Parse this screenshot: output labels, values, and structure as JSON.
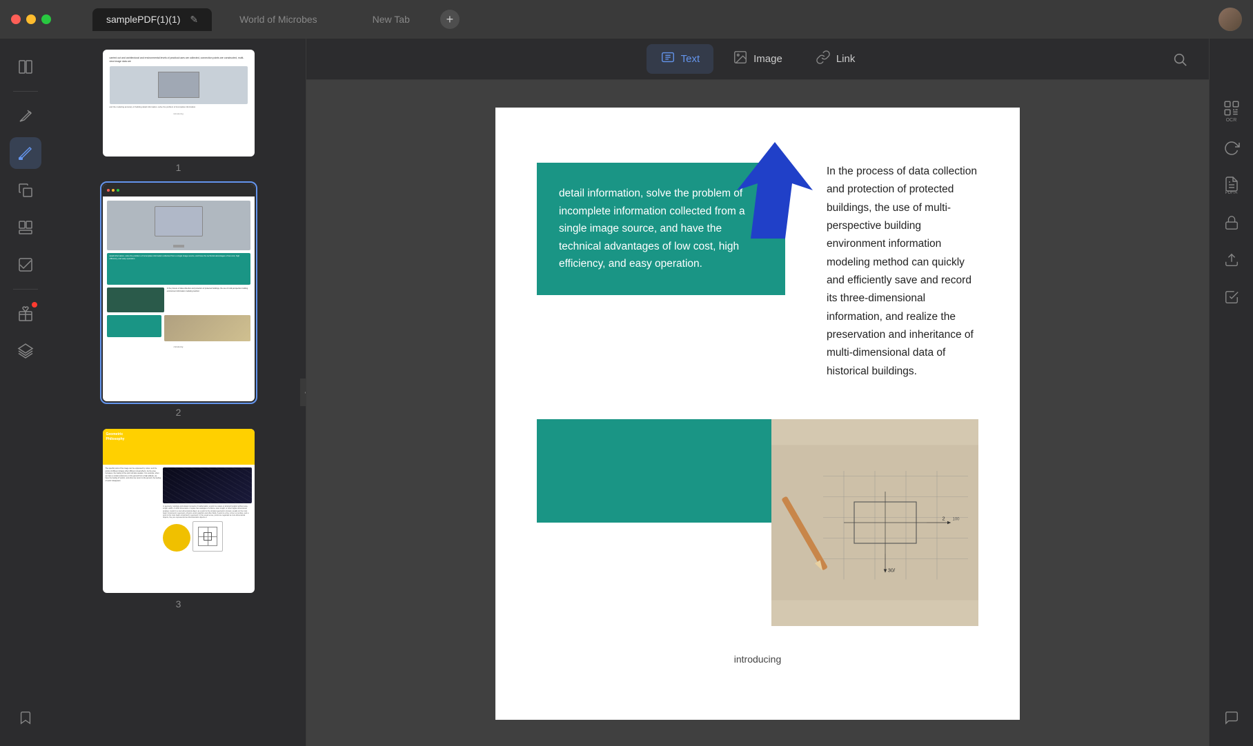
{
  "titlebar": {
    "traffic_lights": [
      "red",
      "yellow",
      "green"
    ],
    "tab_active_label": "samplePDF(1)(1)",
    "tab2_label": "World of Microbes",
    "tab3_label": "New Tab",
    "new_tab_icon": "+",
    "edit_icon": "✎"
  },
  "toolbar": {
    "text_label": "Text",
    "image_label": "Image",
    "link_label": "Link",
    "search_icon": "🔍"
  },
  "sidebar": {
    "items": [
      {
        "id": "reader",
        "icon": "📖",
        "label": "Reader"
      },
      {
        "id": "annotate",
        "icon": "✏️",
        "label": "Annotate",
        "active": true
      },
      {
        "id": "copy",
        "icon": "📋",
        "label": "Copy"
      },
      {
        "id": "organize",
        "icon": "🗂️",
        "label": "Organize"
      },
      {
        "id": "forms",
        "icon": "✅",
        "label": "Forms"
      },
      {
        "id": "gift",
        "icon": "🎁",
        "label": "Gift"
      },
      {
        "id": "layers",
        "icon": "◫",
        "label": "Layers"
      },
      {
        "id": "bookmark",
        "icon": "🔖",
        "label": "Bookmark"
      }
    ]
  },
  "right_sidebar": {
    "items": [
      {
        "id": "ocr",
        "icon": "OCR",
        "label": "OCR"
      },
      {
        "id": "refresh",
        "icon": "↺",
        "label": "Refresh"
      },
      {
        "id": "pdf-a",
        "icon": "PDF/A",
        "label": "PDF/A"
      },
      {
        "id": "lock",
        "icon": "🔒",
        "label": "Lock"
      },
      {
        "id": "share",
        "icon": "↑",
        "label": "Share"
      },
      {
        "id": "check",
        "icon": "✉",
        "label": "Check"
      },
      {
        "id": "comment",
        "icon": "💬",
        "label": "Comment"
      }
    ]
  },
  "thumbnails": [
    {
      "page_num": "1",
      "selected": false
    },
    {
      "page_num": "2",
      "selected": true
    },
    {
      "page_num": "3",
      "selected": false
    }
  ],
  "pdf_content": {
    "teal_paragraph": "detail information, solve the problem of incomplete information collected from a single image source, and have the technical advantages of low cost, high efficiency, and easy operation.",
    "right_paragraph": "In the process of data collection and protection of protected buildings, the use of multi-perspective building environment information modeling method can quickly and efficiently save and record its three-dimensional information, and realize the preservation and inheritance of multi-dimensional data of historical buildings.",
    "introducing_label": "introducing"
  }
}
